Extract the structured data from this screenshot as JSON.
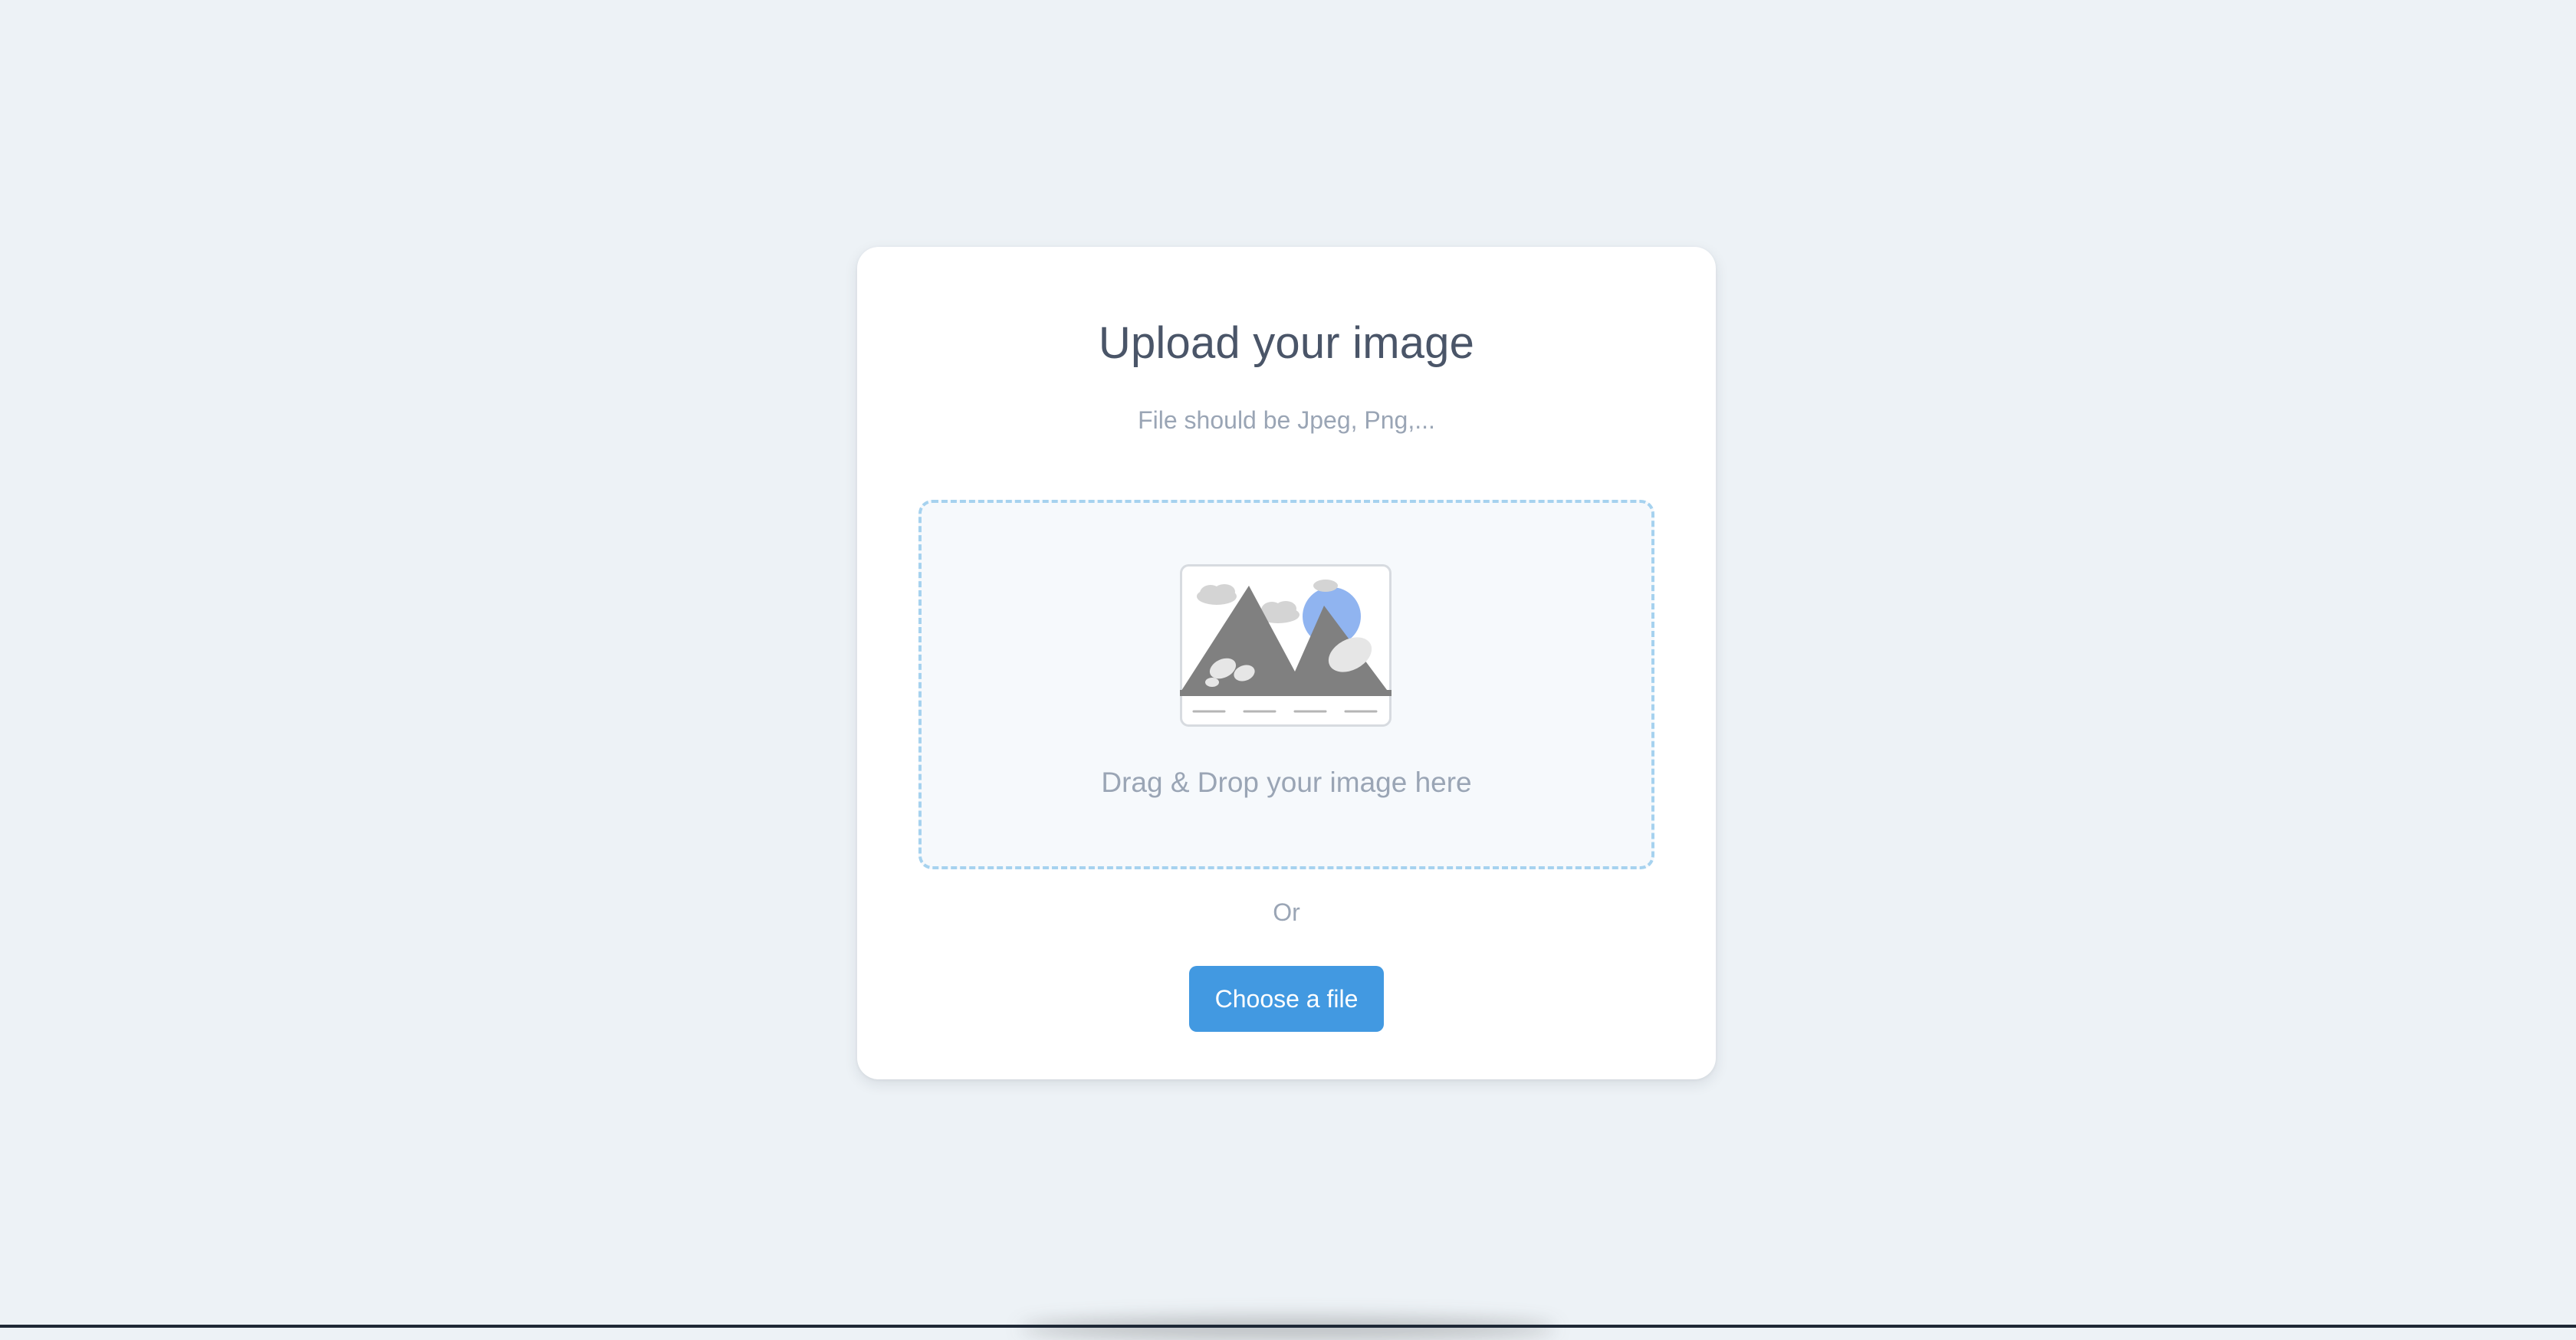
{
  "upload_card": {
    "title": "Upload your image",
    "subtitle": "File should be Jpeg, Png,...",
    "dropzone": {
      "icon": "image-placeholder-icon",
      "label": "Drag & Drop your image here",
      "border_color": "#a6d2ef",
      "background_color": "#f6f9fc"
    },
    "separator": "Or",
    "choose_button": {
      "label": "Choose a file",
      "color": "#4299e1"
    }
  },
  "colors": {
    "page_background": "#edf2f6",
    "card_background": "#ffffff",
    "title_text": "#4a5568",
    "muted_text": "#9aa5b5"
  }
}
